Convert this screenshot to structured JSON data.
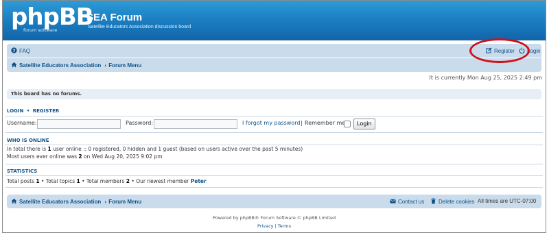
{
  "header": {
    "logo_text": "phpBB",
    "logo_sub": "forum  software",
    "site_title": "SEA Forum",
    "site_desc": "Satellite Educators Association discussion board"
  },
  "navbar": {
    "faq": "FAQ",
    "register": "Register",
    "login": "Login",
    "breadcrumb_home": "Satellite Educators Association",
    "breadcrumb_sep": "‹",
    "breadcrumb_forum": "Forum Menu"
  },
  "time_text": "It is currently Mon Aug 25, 2025 2:49 pm",
  "no_forums": "This board has no forums.",
  "login_section": {
    "title_login": "LOGIN",
    "title_sep": "•",
    "title_register": "REGISTER",
    "username_label": "Username:",
    "password_label": "Password:",
    "forgot": "I forgot my password",
    "remember": "Remember me",
    "login_button": "Login"
  },
  "online_section": {
    "title": "WHO IS ONLINE",
    "line1_pre": "In total there is ",
    "line1_count": "1",
    "line1_post": " user online :: 0 registered, 0 hidden and 1 guest (based on users active over the past 5 minutes)",
    "line2_pre": "Most users ever online was ",
    "line2_count": "2",
    "line2_post": " on Wed Aug 20, 2025 9:02 pm"
  },
  "stats_section": {
    "title": "STATISTICS",
    "posts_label": "Total posts ",
    "posts": "1",
    "topics_label": " • Total topics ",
    "topics": "1",
    "members_label": " • Total members ",
    "members": "2",
    "newest_label": " • Our newest member ",
    "newest": "Peter"
  },
  "footer": {
    "breadcrumb_home": "Satellite Educators Association",
    "breadcrumb_sep": "‹",
    "breadcrumb_forum": "Forum Menu",
    "contact": "Contact us",
    "delete_cookies": "Delete cookies",
    "timezone": "All times are UTC-07:00",
    "powered": "Powered by phpBB® Forum Software © phpBB Limited",
    "privacy": "Privacy",
    "sep": "|",
    "terms": "Terms"
  },
  "colors": {
    "header_blue": "#1a7bbf",
    "nav_bg": "#cadceb",
    "link": "#105289",
    "highlight_circle": "#d3101a"
  }
}
